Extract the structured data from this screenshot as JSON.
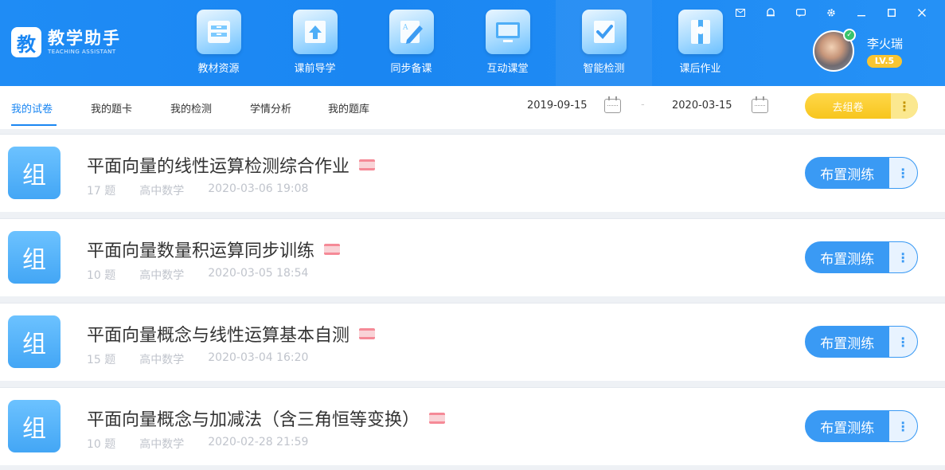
{
  "app": {
    "logo_char": "教",
    "title": "教学助手",
    "subtitle": "TEACHING ASSISTANT"
  },
  "nav": [
    {
      "label": "教材资源",
      "icon": "bookshelf-icon"
    },
    {
      "label": "课前导学",
      "icon": "upload-book-icon"
    },
    {
      "label": "同步备课",
      "icon": "pencil-doc-icon"
    },
    {
      "label": "互动课堂",
      "icon": "whiteboard-icon"
    },
    {
      "label": "智能检测",
      "icon": "checkmark-doc-icon"
    },
    {
      "label": "课后作业",
      "icon": "bookmark-icon"
    }
  ],
  "user": {
    "name": "李火瑞",
    "level": "LV.5"
  },
  "window_controls": [
    "mail-icon",
    "bell-icon",
    "chat-icon",
    "gear-icon",
    "minimize-icon",
    "maximize-icon",
    "close-icon"
  ],
  "tabs": [
    {
      "label": "我的试卷",
      "active": true
    },
    {
      "label": "我的题卡",
      "active": false
    },
    {
      "label": "我的检测",
      "active": false
    },
    {
      "label": "学情分析",
      "active": false
    },
    {
      "label": "我的题库",
      "active": false
    }
  ],
  "date_range": {
    "start": "2019-09-15",
    "end": "2020-03-15",
    "separator": "-"
  },
  "toolbar": {
    "go_button": "去组卷",
    "more": "⋮"
  },
  "papers": [
    {
      "icon_char": "组",
      "title": "平面向量的线性运算检测综合作业",
      "count": "17 题",
      "subject": "高中数学",
      "time": "2020-03-06 19:08",
      "action": "布置测练",
      "more": "⋮"
    },
    {
      "icon_char": "组",
      "title": "平面向量数量积运算同步训练",
      "count": "10 题",
      "subject": "高中数学",
      "time": "2020-03-05 18:54",
      "action": "布置测练",
      "more": "⋮"
    },
    {
      "icon_char": "组",
      "title": "平面向量概念与线性运算基本自测",
      "count": "15 题",
      "subject": "高中数学",
      "time": "2020-03-04 16:20",
      "action": "布置测练",
      "more": "⋮"
    },
    {
      "icon_char": "组",
      "title": "平面向量概念与加减法（含三角恒等变换）",
      "count": "10 题",
      "subject": "高中数学",
      "time": "2020-02-28 21:59",
      "action": "布置测练",
      "more": "⋮"
    }
  ],
  "colors": {
    "primary": "#1a86f2",
    "accent_yellow": "#f7c51d",
    "card_icon": "#43a6f5",
    "badge": "#f58a97"
  }
}
